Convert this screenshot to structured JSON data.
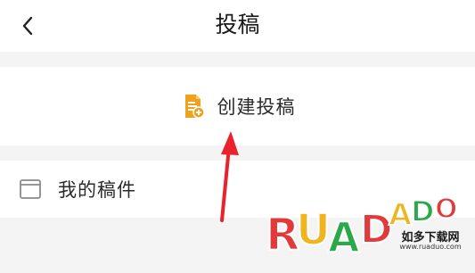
{
  "header": {
    "title": "投稿",
    "back_icon": "chevron-left-icon"
  },
  "actions": {
    "create_label": "创建投稿",
    "create_icon": "document-add-icon",
    "create_icon_color": "#f0a21f",
    "drafts_label": "我的稿件",
    "drafts_icon": "window-icon"
  },
  "watermark": {
    "logo_text": "RUADADO",
    "subtitle": "如多下载网",
    "url": "www.ruaduo.com"
  },
  "colors": {
    "background": "#f4f4f4",
    "surface": "#ffffff",
    "annotation_arrow": "#e8232c"
  }
}
